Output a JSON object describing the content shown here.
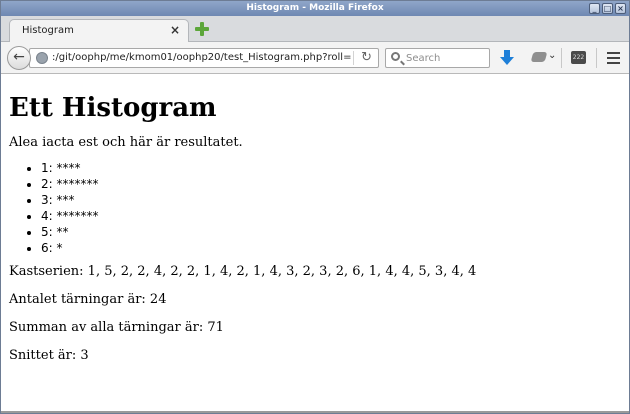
{
  "window": {
    "title": "Histogram - Mozilla Firefox",
    "controls": [
      "_",
      "□",
      "×"
    ]
  },
  "tab": {
    "label": "Histogram",
    "close": "×"
  },
  "navbar": {
    "back": "←",
    "url": ":/git/oophp/me/kmom01/oophp20/test_Histogram.php?roll=",
    "reload": "↻",
    "search_placeholder": "Search",
    "dropdown": "⌄",
    "badge": "222"
  },
  "page": {
    "heading": "Ett Histogram",
    "intro": "Alea iacta est och här är resultatet.",
    "histogram": [
      "1: ****",
      "2: *******",
      "3: ***",
      "4: *******",
      "5: **",
      "6: *"
    ],
    "series": "Kastserien: 1, 5, 2, 2, 4, 2, 2, 1, 4, 2, 1, 4, 3, 2, 3, 2, 6, 1, 4, 4, 5, 3, 4, 4",
    "count": "Antalet tärningar är: 24",
    "sum": "Summan av alla tärningar är: 71",
    "average": "Snittet är: 3"
  }
}
